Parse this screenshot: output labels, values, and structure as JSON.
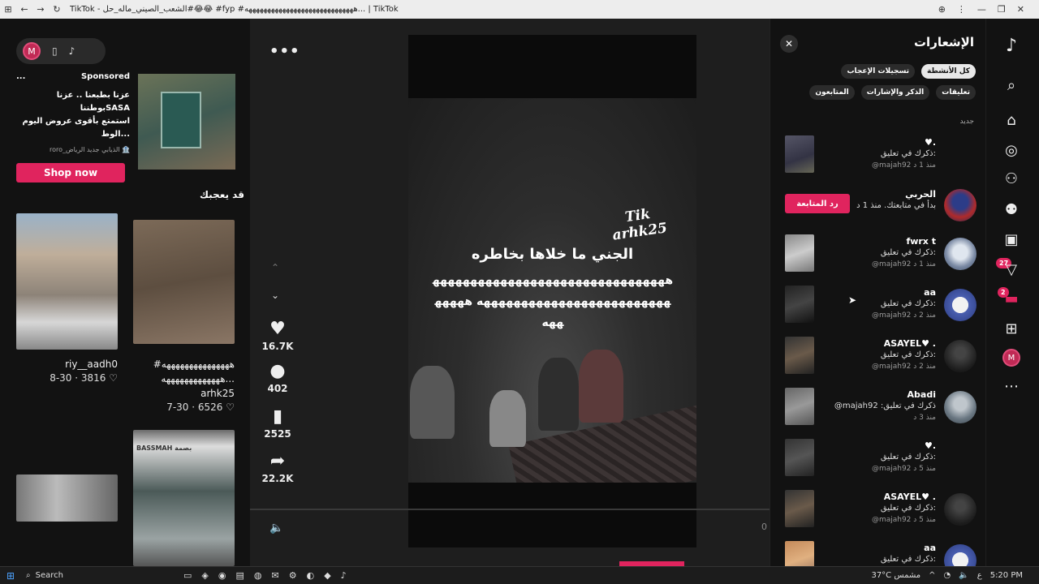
{
  "window": {
    "title": "TikTok - الشعب_الصيني_ماله_حل#😂😂 #fyp #هههههههههههههههههههههههههههههه... | TikTok"
  },
  "left": {
    "pill": {
      "avatar_letter": "M"
    },
    "ad": {
      "dots": "...",
      "label": "Sponsored",
      "text_line1": "عزنا بطبعنا .. عزنا بوطنناSASA",
      "text_line2": "استمتع بأقوى عروض اليوم الوط...",
      "advertiser": "roro_الذيابي جديد الرياض 🏦",
      "button": "Shop now"
    },
    "suggest_title": "قد يعجبك",
    "videos": [
      {
        "caption": "riy__aadh0",
        "meta": "8-30 · 3816 ♡"
      },
      {
        "caption": "#هههههههههههههههه هههههههههههههه...",
        "author": "arhk25",
        "meta": "7-30 · 6526 ♡"
      }
    ],
    "bassmah_logo": "BASSMAH بصمة"
  },
  "player": {
    "more": "•••",
    "overlay_title": "الجني ما خلاها بخاطره",
    "overlay_laugh": "هههههههههههههههههههههههههههههههههههههههههههههههههههههههههه هههههههه",
    "watermark_1": "Tik",
    "watermark_2": "arhk25",
    "time_right": "0",
    "actions": [
      {
        "icon": "heart-icon",
        "count": "16.7K"
      },
      {
        "icon": "comment-icon",
        "count": "402"
      },
      {
        "icon": "bookmark-icon",
        "count": "2525"
      },
      {
        "icon": "share-icon",
        "count": "22.2K"
      }
    ]
  },
  "notifications": {
    "title": "الإشعارات",
    "chips": [
      {
        "label": "كل الأنشطة",
        "active": true
      },
      {
        "label": "تسجيلات الإعجاب",
        "active": false
      },
      {
        "label": "تعليقات",
        "active": false
      },
      {
        "label": "الذكر والإشارات",
        "active": false
      },
      {
        "label": "المتابعون",
        "active": false
      }
    ],
    "section_new": "جديد",
    "items": [
      {
        "name": "♥.",
        "line": "ذكرك في تعليق:",
        "time": "@majah92 منذ 1 د"
      },
      {
        "name": "الحربي",
        "line": "بدأ في متابعتك. منذ 1 د",
        "time": "",
        "button": "رد المتابعة"
      },
      {
        "name": "fwrx t",
        "line": "ذكرك في تعليق:",
        "time": "@majah92 منذ 1 د"
      },
      {
        "name": "aa",
        "line": "ذكرك في تعليق:",
        "time": "@majah92 منذ 2 د"
      },
      {
        "name": "ASAYEL♥ .",
        "line": "ذكرك في تعليق:",
        "time": "@majah92 منذ 2 د"
      },
      {
        "name": "Abadi",
        "line": "@majah92 :ذكرك في تعليق",
        "time": "منذ 3 د"
      },
      {
        "name": "♥.",
        "line": "ذكرك في تعليق:",
        "time": "@majah92 منذ 5 د"
      },
      {
        "name": "ASAYEL♥ .",
        "line": "ذكرك في تعليق:",
        "time": "@majah92 منذ 5 د"
      },
      {
        "name": "aa",
        "line": "ذكرك في تعليق:",
        "time": ""
      }
    ]
  },
  "nav": {
    "badges": {
      "activity": "27",
      "messages": "2"
    },
    "avatar_letter": "M"
  },
  "taskbar": {
    "search": "Search",
    "weather": "37°C مشمس",
    "lang": "ع",
    "time": "5:20 PM"
  }
}
